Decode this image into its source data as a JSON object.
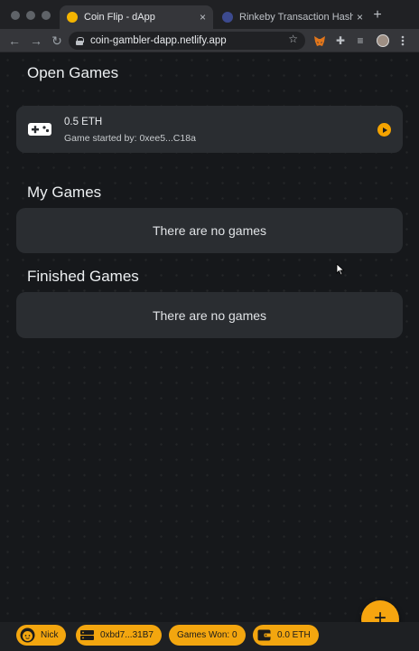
{
  "browser": {
    "tabs": [
      {
        "title": "Coin Flip - dApp",
        "close": "×",
        "favicon_color": "#f4b400"
      },
      {
        "title": "Rinkeby Transaction Hash (Tx",
        "close": "×",
        "favicon_color": "#7986cb"
      }
    ],
    "new_tab": "+",
    "nav": {
      "back": "←",
      "forward": "→",
      "reload": "↻"
    },
    "url": "coin-gambler-dapp.netlify.app",
    "bookmark": "☆",
    "extensions": {
      "puzzle": "✚",
      "menu": "≡"
    }
  },
  "app": {
    "open_games": {
      "title": "Open Games",
      "games": [
        {
          "amount": "0.5 ETH",
          "started_by": "Game started by: 0xee5...C18a"
        }
      ]
    },
    "my_games": {
      "title": "My Games",
      "empty": "There are no games"
    },
    "finished_games": {
      "title": "Finished Games",
      "empty": "There are no games"
    },
    "fab_label": "+",
    "accent": "#f3a60f"
  },
  "status_bar": {
    "user": "Nick",
    "address": "0xbd7...31B7",
    "games_won": "Games Won: 0",
    "balance": "0.0 ETH"
  }
}
